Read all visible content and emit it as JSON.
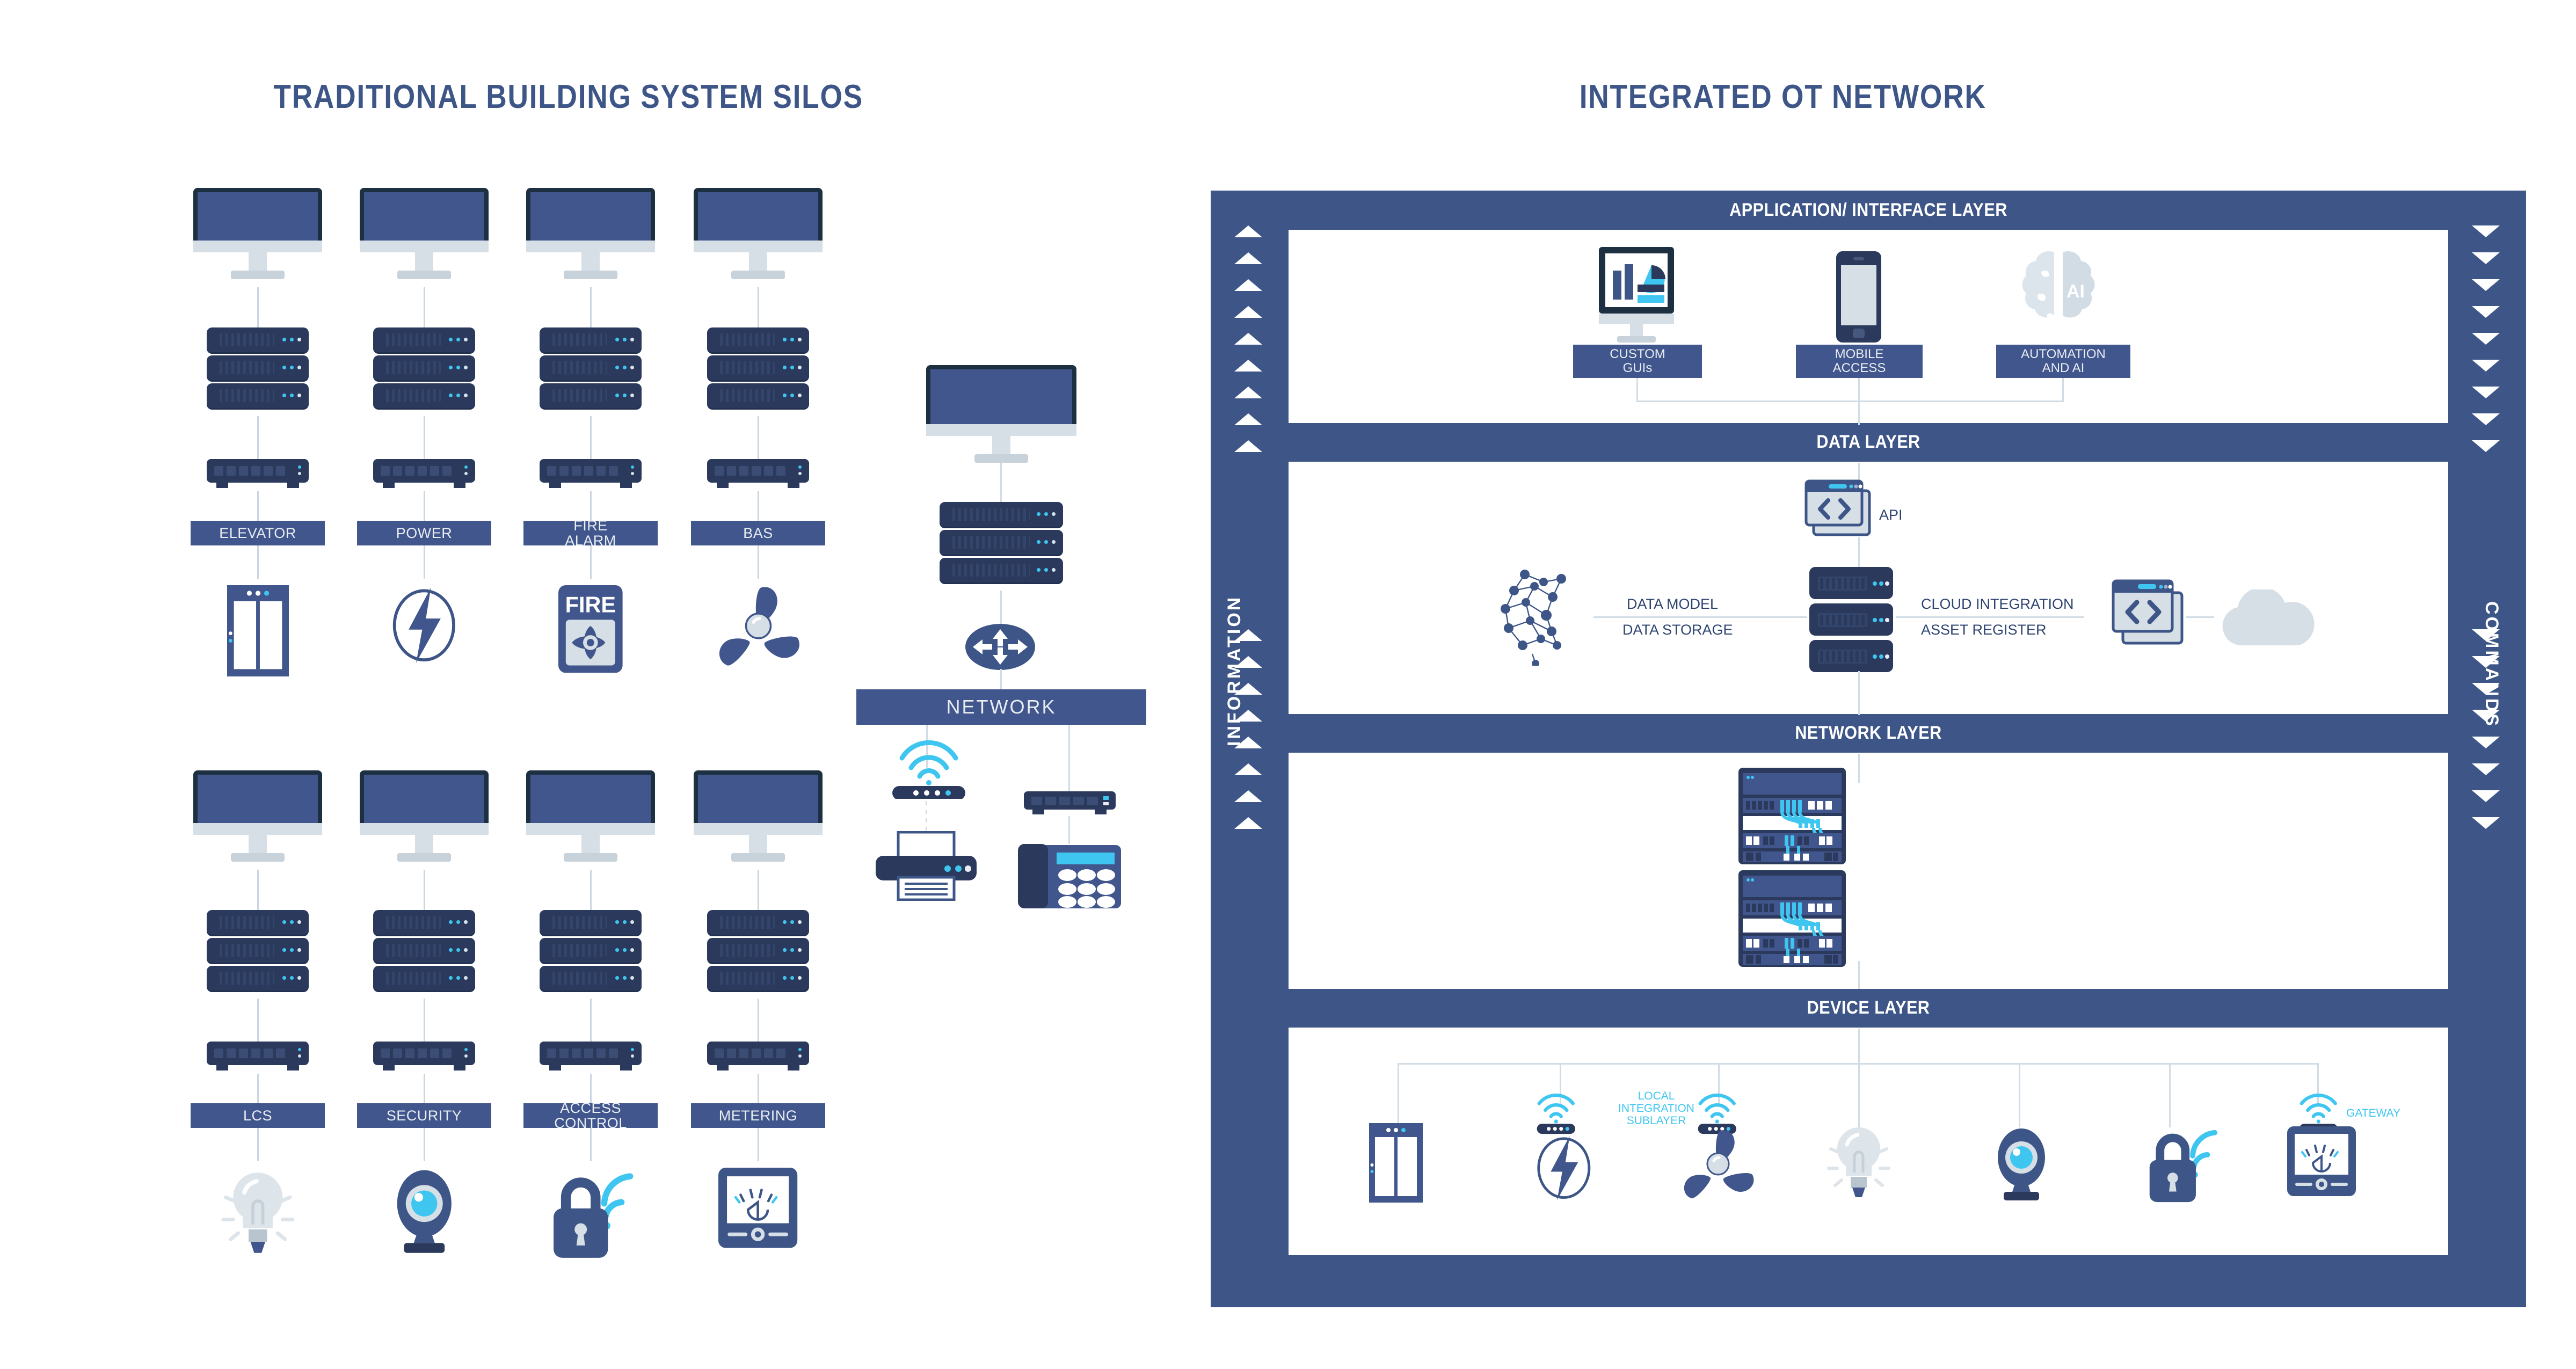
{
  "left_panel": {
    "title": "TRADITIONAL BUILDING SYSTEM SILOS",
    "silos_row1": [
      {
        "label": "ELEVATOR",
        "device_icon": "elevator-icon"
      },
      {
        "label": "POWER",
        "device_icon": "lightning-bolt-icon"
      },
      {
        "label": "FIRE\nALARM",
        "device_icon": "fire-alarm-icon",
        "device_text": "FIRE"
      },
      {
        "label": "BAS",
        "device_icon": "fan-propeller-icon"
      }
    ],
    "silos_row2": [
      {
        "label": "LCS",
        "device_icon": "lightbulb-icon"
      },
      {
        "label": "SECURITY",
        "device_icon": "camera-icon"
      },
      {
        "label": "ACCESS\nCONTROL",
        "device_icon": "padlock-wifi-icon"
      },
      {
        "label": "METERING",
        "device_icon": "meter-gauge-icon"
      }
    ],
    "network_cluster": {
      "label": "NETWORK",
      "monitor_icon": "desktop-monitor-icon",
      "server_icon": "server-rack-icon",
      "router_icon": "router-switch-icon",
      "wifi_router_icon": "wifi-router-icon",
      "switch_icon": "network-switch-icon",
      "printer_icon": "printer-icon",
      "phone_icon": "desk-phone-icon"
    }
  },
  "right_panel": {
    "title": "INTEGRATED OT NETWORK",
    "side_left_label": "INFORMATION",
    "side_right_label": "COMMANDS",
    "layers": [
      {
        "name": "APPLICATION/ INTERFACE LAYER"
      },
      {
        "name": "DATA LAYER"
      },
      {
        "name": "NETWORK LAYER"
      },
      {
        "name": "DEVICE LAYER"
      }
    ],
    "application_layer": {
      "items": [
        {
          "label": "CUSTOM\nGUIs",
          "icon": "dashboard-monitor-icon"
        },
        {
          "label": "MOBILE\nACCESS",
          "icon": "smartphone-icon"
        },
        {
          "label": "AUTOMATION\nAND AI",
          "icon": "ai-brain-icon"
        }
      ]
    },
    "data_layer": {
      "api_label": "API",
      "api_icon": "code-window-icon",
      "neural_icon": "neural-network-brain-icon",
      "server_icon": "database-server-icon",
      "cloud_icon": "cloud-icon",
      "cloud_code_icon": "code-window-icon",
      "labels_left": [
        "DATA MODEL",
        "DATA STORAGE"
      ],
      "labels_right": [
        "CLOUD INTEGRATION",
        "ASSET REGISTER"
      ]
    },
    "network_layer": {
      "rack_icon": "network-rack-cabinet-icon",
      "rack_count": 2
    },
    "device_layer": {
      "sublayer_label": "LOCAL\nINTEGRATION\nSUBLAYER",
      "gateway_label": "GATEWAY",
      "devices": [
        {
          "icon": "elevator-icon"
        },
        {
          "icon": "lightning-bolt-icon"
        },
        {
          "icon": "fan-propeller-icon"
        },
        {
          "icon": "lightbulb-icon"
        },
        {
          "icon": "camera-icon"
        },
        {
          "icon": "padlock-wifi-icon"
        },
        {
          "icon": "meter-gauge-icon"
        }
      ],
      "gateways": [
        "gateway-node-icon",
        "gateway-node-icon",
        "gateway-node-icon"
      ]
    }
  },
  "colors": {
    "primary_blue": "#3D5687",
    "chip_blue": "#41568C",
    "dark_navy": "#2B3A5C",
    "cyan": "#3EC6F0",
    "light_grey": "#D6DEE6",
    "line_grey": "#D2DCE4"
  }
}
